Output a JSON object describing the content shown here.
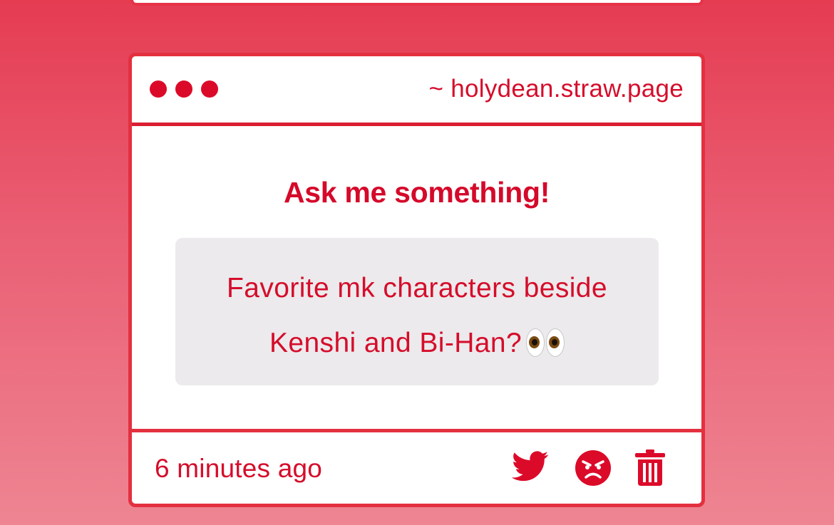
{
  "header": {
    "site_url": "~ holydean.straw.page"
  },
  "main": {
    "prompt_title": "Ask me something!",
    "question": {
      "line1": "Favorite mk characters beside",
      "line2": "Kenshi and Bi-Han?",
      "emoji": "eyes"
    }
  },
  "footer": {
    "timestamp": "6 minutes ago",
    "actions": [
      {
        "icon": "twitter-bird-icon"
      },
      {
        "icon": "angry-face-icon"
      },
      {
        "icon": "trash-icon"
      }
    ]
  },
  "colors": {
    "accent": "#d50d2b",
    "border": "#e3303f",
    "question_bg": "#eceaec"
  }
}
